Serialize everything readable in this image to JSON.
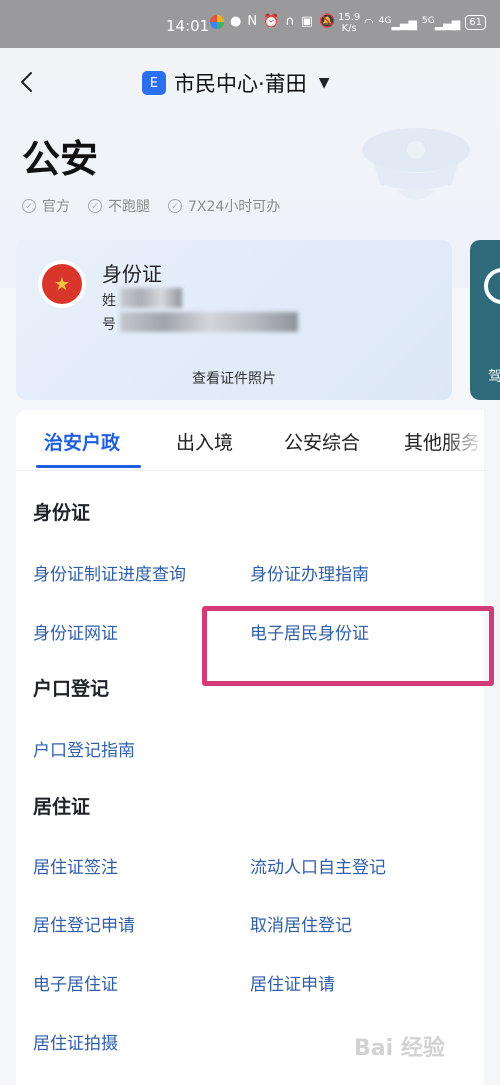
{
  "status_bar": {
    "time": "14:01",
    "speed_value": "15.9",
    "speed_unit": "K/s",
    "battery": "61",
    "signal1": "4G",
    "signal2": "5G"
  },
  "header": {
    "city_badge": "E",
    "city_name": "市民中心·莆田",
    "title": "公安",
    "tags": [
      "官方",
      "不跑腿",
      "7X24小时可办"
    ]
  },
  "id_card": {
    "title": "身份证",
    "name_prefix": "姓",
    "number_prefix": "号",
    "view_photo": "查看证件照片",
    "next_card_label": "驾"
  },
  "tabs": [
    {
      "label": "治安户政",
      "active": true
    },
    {
      "label": "出入境",
      "active": false
    },
    {
      "label": "公安综合",
      "active": false
    },
    {
      "label": "其他服务",
      "active": false
    }
  ],
  "sections": {
    "id": {
      "title": "身份证",
      "items": [
        "身份证制证进度查询",
        "身份证办理指南",
        "身份证网证",
        "电子居民身份证"
      ]
    },
    "hukou": {
      "title": "户口登记",
      "items": [
        "户口登记指南"
      ]
    },
    "residence": {
      "title": "居住证",
      "items": [
        "居住证签注",
        "流动人口自主登记",
        "居住登记申请",
        "取消居住登记",
        "电子居住证",
        "居住证申请",
        "居住证拍摄"
      ]
    }
  },
  "watermark": "Bai 经验",
  "colors": {
    "accent": "#1f5fe0",
    "link": "#2f5fa8",
    "highlight": "#d23a78"
  }
}
